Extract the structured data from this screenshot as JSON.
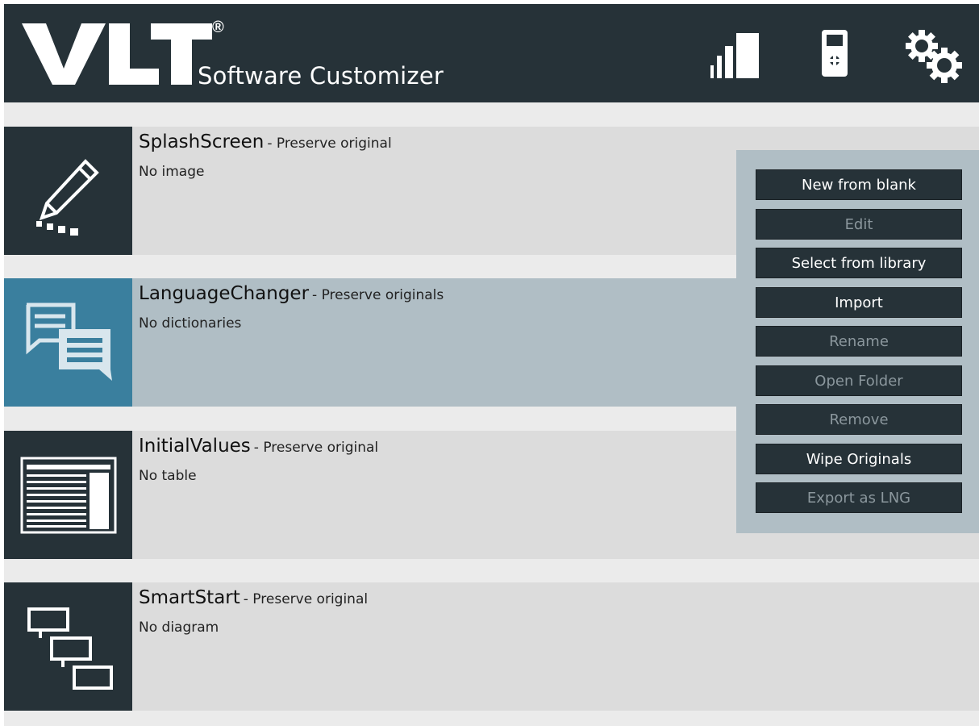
{
  "app": {
    "logo_text": "VLT",
    "registered_mark": "®",
    "subtitle": "Software Customizer"
  },
  "header": {
    "icons": [
      "signal-bars-icon",
      "handheld-device-icon",
      "settings-gears-icon"
    ]
  },
  "modules": [
    {
      "name": "SplashScreen",
      "mode": "- Preserve original",
      "desc": "No image",
      "icon": "pencil-icon",
      "selected": false
    },
    {
      "name": "LanguageChanger",
      "mode": "- Preserve originals",
      "desc": "No dictionaries",
      "icon": "chat-bubbles-icon",
      "selected": true
    },
    {
      "name": "InitialValues",
      "mode": "- Preserve original",
      "desc": "No table",
      "icon": "table-icon",
      "selected": false
    },
    {
      "name": "SmartStart",
      "mode": "- Preserve original",
      "desc": "No diagram",
      "icon": "flow-diagram-icon",
      "selected": false
    }
  ],
  "actions": [
    {
      "label": "New from blank",
      "enabled": true
    },
    {
      "label": "Edit",
      "enabled": false
    },
    {
      "label": "Select from library",
      "enabled": true
    },
    {
      "label": "Import",
      "enabled": true
    },
    {
      "label": "Rename",
      "enabled": false
    },
    {
      "label": "Open Folder",
      "enabled": false
    },
    {
      "label": "Remove",
      "enabled": false
    },
    {
      "label": "Wipe Originals",
      "enabled": true
    },
    {
      "label": "Export as LNG",
      "enabled": false
    }
  ],
  "colors": {
    "header_bg": "#263238",
    "selected_row": "#b0bec5",
    "selected_icon": "#3a7f9e",
    "row_bg": "#dcdcdc"
  }
}
